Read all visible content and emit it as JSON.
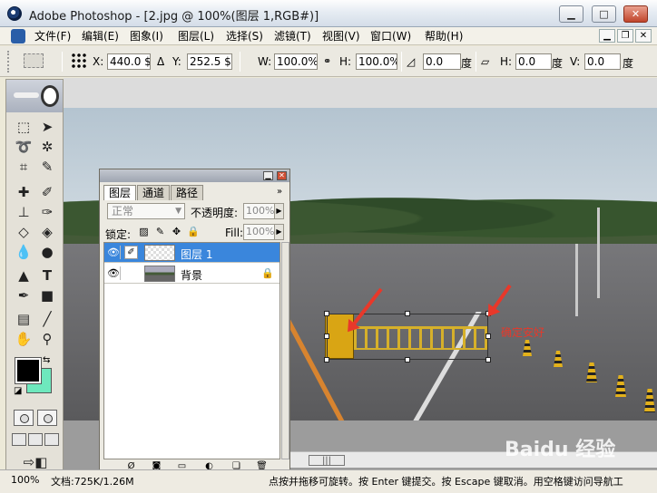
{
  "window": {
    "title": "Adobe Photoshop - [2.jpg @ 100%(图层 1,RGB#)]",
    "minimize": "▁",
    "maximize": "□",
    "close": "✕"
  },
  "menu": {
    "items": [
      "文件(F)",
      "编辑(E)",
      "图象(I)",
      "图层(L)",
      "选择(S)",
      "滤镜(T)",
      "视图(V)",
      "窗口(W)",
      "帮助(H)"
    ],
    "doc_min": "▁",
    "doc_restore": "❐",
    "doc_close": "✕"
  },
  "options": {
    "x_label": "X:",
    "x_value": "440.0 $",
    "delta_icon": "Δ",
    "y_label": "Y:",
    "y_value": "252.5 $",
    "w_label": "W:",
    "w_value": "100.0%",
    "h_label": "H:",
    "h_value": "100.0%",
    "rotate_value": "0.0",
    "rotate_unit": "度",
    "hskew_label": "H:",
    "hskew_value": "0.0",
    "hskew_unit": "度",
    "vskew_label": "V:",
    "vskew_value": "0.0",
    "vskew_unit": "度"
  },
  "layers_panel": {
    "tabs": [
      "图层",
      "通道",
      "路径"
    ],
    "blend_mode": "正常",
    "opacity_label": "不透明度:",
    "opacity_value": "100%",
    "lock_label": "锁定:",
    "fill_label": "Fill:",
    "fill_value": "100%",
    "layers": [
      {
        "name": "图层 1",
        "selected": true
      },
      {
        "name": "背景",
        "selected": false,
        "locked": true
      }
    ]
  },
  "canvas": {
    "annotation": "确定安好"
  },
  "status": {
    "zoom": "100%",
    "doc_info": "文档:725K/1.26M",
    "hint": "点按并拖移可旋转。按 Enter 键提交。按 Escape 键取消。用空格键访问导航工"
  },
  "watermark": "Baidu 经验",
  "colors": {
    "foreground": "#000000",
    "background": "#6ee8bd",
    "selection": "#3a86dc",
    "annotation": "#e8382a"
  }
}
